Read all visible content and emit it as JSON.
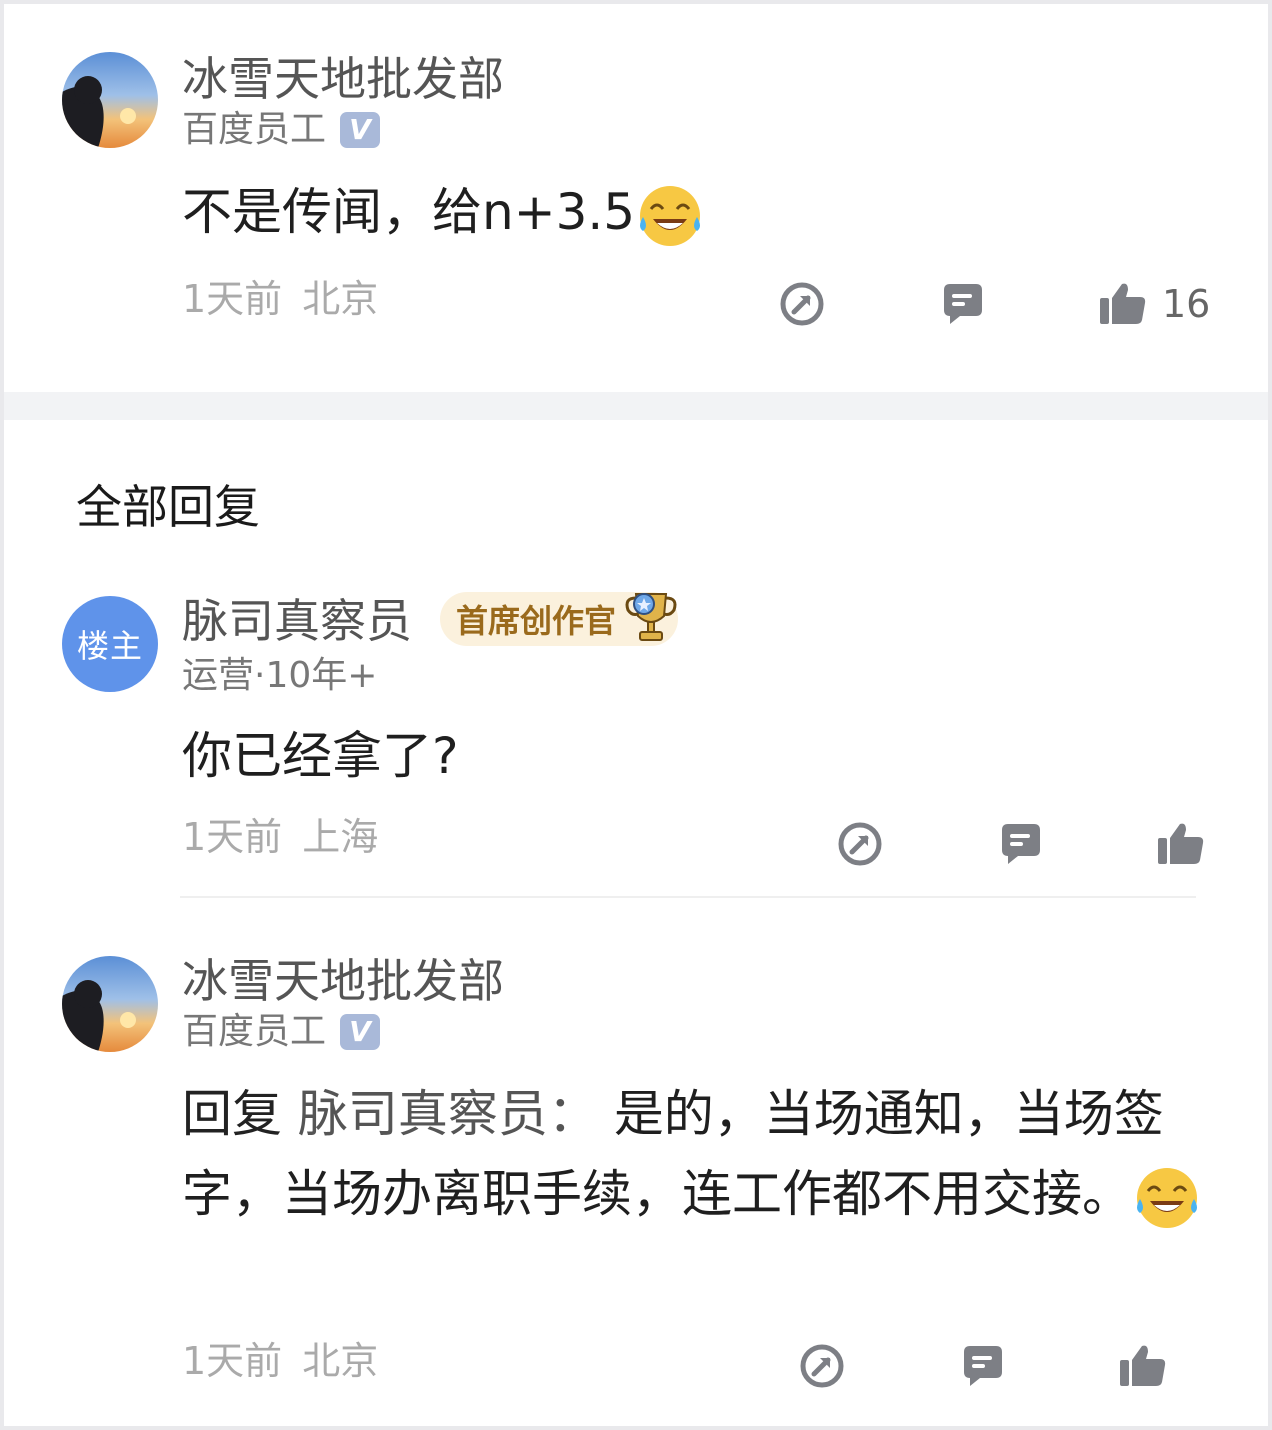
{
  "comment": {
    "author": "冰雪天地批发部",
    "subtitle": "百度员工",
    "verified_mark": "V",
    "text": "不是传闻，给n+3.5",
    "emoji": "laughing-tears-emoji",
    "time": "1天前",
    "location": "北京",
    "like_count": "16"
  },
  "replies_section": {
    "title": "全部回复"
  },
  "replies": [
    {
      "avatar_label": "楼主",
      "author": "脉司真察员",
      "badge": "首席创作官",
      "subtitle": "运营·10年+",
      "text": "你已经拿了?",
      "time": "1天前",
      "location": "上海"
    },
    {
      "author": "冰雪天地批发部",
      "subtitle": "百度员工",
      "verified_mark": "V",
      "reply_prefix": "回复",
      "reply_target": "脉司真察员：",
      "text": "是的，当场通知，当场签字，当场办离职手续，连工作都不用交接。",
      "emoji": "laughing-tears-emoji",
      "time": "1天前",
      "location": "北京"
    }
  ],
  "icons": {
    "share": "share-icon",
    "comment": "comment-icon",
    "like": "thumbs-up-icon"
  },
  "colors": {
    "host_avatar": "#5f93ea",
    "badge_bg": "#fbf1dd",
    "badge_text": "#9a6a1c",
    "icon_gray": "#7d7f85",
    "separator": "#f2f3f5"
  }
}
